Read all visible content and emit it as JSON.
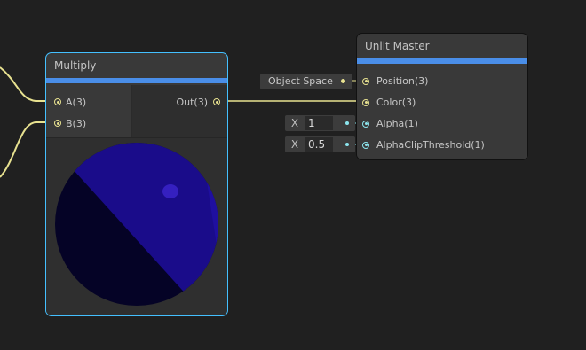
{
  "multiply_node": {
    "title": "Multiply",
    "inputs": [
      {
        "label": "A(3)"
      },
      {
        "label": "B(3)"
      }
    ],
    "output": {
      "label": "Out(3)"
    },
    "preview_color": "#1a0c8a"
  },
  "master_node": {
    "title": "Unlit Master",
    "ports": [
      {
        "label": "Position(3)"
      },
      {
        "label": "Color(3)"
      },
      {
        "label": "Alpha(1)"
      },
      {
        "label": "AlphaClipThreshold(1)"
      }
    ]
  },
  "position_property": {
    "label": "Object Space"
  },
  "alpha_field": {
    "axis": "X",
    "value": "1"
  },
  "alpha_clip_field": {
    "axis": "X",
    "value": "0.5"
  },
  "colors": {
    "accent": "#4a8ee8",
    "vector3_port": "#e8e290",
    "vector1_port": "#8ce6ee",
    "selection": "#44c0ff"
  }
}
